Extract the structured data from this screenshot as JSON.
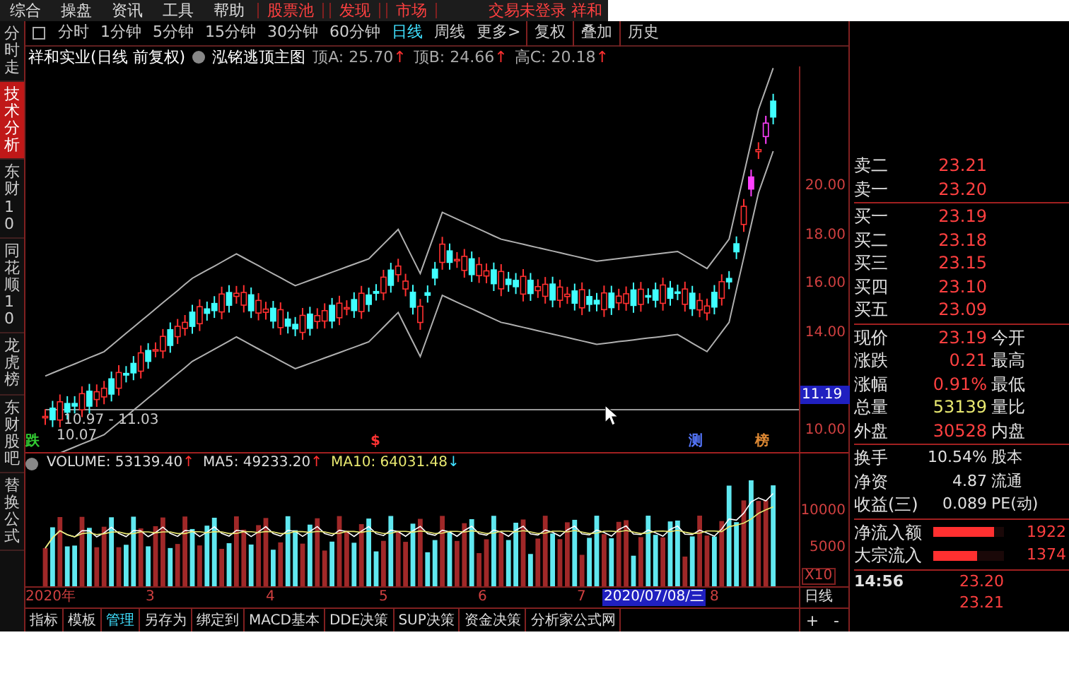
{
  "menu": {
    "items": [
      {
        "label": "综合",
        "kind": "plain"
      },
      {
        "label": "操盘",
        "kind": "plain"
      },
      {
        "label": "资讯",
        "kind": "plain"
      },
      {
        "label": "工具",
        "kind": "plain"
      },
      {
        "label": "帮助",
        "kind": "plain"
      },
      {
        "label": "股票池",
        "kind": "red"
      },
      {
        "label": "发现",
        "kind": "red"
      },
      {
        "label": "市场",
        "kind": "red"
      }
    ],
    "status": "交易未登录 祥和"
  },
  "side_tabs": [
    {
      "label": "分时走",
      "selected": false
    },
    {
      "label": "技术分析",
      "selected": true
    },
    {
      "label": "东财10",
      "selected": false
    },
    {
      "label": "同花顺10",
      "selected": false
    },
    {
      "label": "龙虎榜",
      "selected": false
    },
    {
      "label": "东财股吧",
      "selected": false
    },
    {
      "label": "替换公式",
      "selected": false
    }
  ],
  "period_tabs": [
    {
      "label": "分时",
      "selected": false
    },
    {
      "label": "1分钟",
      "selected": false
    },
    {
      "label": "5分钟",
      "selected": false
    },
    {
      "label": "15分钟",
      "selected": false
    },
    {
      "label": "30分钟",
      "selected": false
    },
    {
      "label": "60分钟",
      "selected": false
    },
    {
      "label": "日线",
      "selected": true
    },
    {
      "label": "周线",
      "selected": false
    },
    {
      "label": "更多>",
      "selected": false
    }
  ],
  "tool_buttons": [
    "复权",
    "叠加",
    "历史"
  ],
  "info": {
    "stock": "祥和实业(日线 前复权)",
    "indicator": "泓铭逃顶主图",
    "readings": [
      {
        "label": "顶A: 25.70",
        "arrow": "↑",
        "color": "#ff3030"
      },
      {
        "label": "顶B: 24.66",
        "arrow": "↑",
        "color": "#ff3030"
      },
      {
        "label": "高C: 20.18",
        "arrow": "↑",
        "color": "#ff3030"
      }
    ]
  },
  "chart": {
    "range_label": "10.97 - 11.03",
    "low_label": "10.07",
    "markers": [
      {
        "label": "跌",
        "color": "#33cc33"
      },
      {
        "label": "$",
        "color": "#ff3333"
      },
      {
        "label": "测",
        "color": "#5577ff"
      },
      {
        "label": "榜",
        "color": "#dd8833"
      }
    ]
  },
  "price_axis": {
    "labels": [
      "20.00",
      "18.00",
      "16.00",
      "14.00",
      "10.00"
    ],
    "current": "11.19"
  },
  "volume": {
    "readings": [
      {
        "label": "VOLUME: 53139.40",
        "arrow": "↑",
        "color": "#ff3030",
        "kind": "plain"
      },
      {
        "label": "MA5: 49233.20",
        "arrow": "↑",
        "color": "#ff3030",
        "kind": "plain"
      },
      {
        "label": "MA10: 64031.48",
        "arrow": "↓",
        "color": "#40e0ff",
        "kind": "yellow"
      }
    ],
    "axis": [
      "10000",
      "5000"
    ],
    "scale": "X10"
  },
  "dates": [
    {
      "label": "2020年",
      "selected": false
    },
    {
      "label": "3",
      "selected": false
    },
    {
      "label": "4",
      "selected": false
    },
    {
      "label": "5",
      "selected": false
    },
    {
      "label": "6",
      "selected": false
    },
    {
      "label": "7",
      "selected": false
    },
    {
      "label": "2020/07/08/三",
      "selected": true
    },
    {
      "label": "8",
      "selected": false
    }
  ],
  "period_label": "日线",
  "bottom_tabs": [
    {
      "label": "指标",
      "selected": false
    },
    {
      "label": "模板",
      "selected": false
    },
    {
      "label": "管理",
      "selected": true
    },
    {
      "label": "另存为",
      "selected": false
    },
    {
      "label": "绑定到",
      "selected": false
    },
    {
      "label": "MACD基本",
      "selected": false
    },
    {
      "label": "DDE决策",
      "selected": false
    },
    {
      "label": "SUP决策",
      "selected": false
    },
    {
      "label": "资金决策",
      "selected": false
    },
    {
      "label": "分析家公式网",
      "selected": false
    }
  ],
  "zoom_buttons": [
    "+",
    "-"
  ],
  "quote": {
    "asks": [
      {
        "label": "卖二",
        "value": "23.21"
      },
      {
        "label": "卖一",
        "value": "23.20"
      }
    ],
    "bids": [
      {
        "label": "买一",
        "value": "23.19"
      },
      {
        "label": "买二",
        "value": "23.18"
      },
      {
        "label": "买三",
        "value": "23.15"
      },
      {
        "label": "买四",
        "value": "23.10"
      },
      {
        "label": "买五",
        "value": "23.09"
      }
    ],
    "stats": [
      {
        "label": "现价",
        "value": "23.19",
        "extra": "今开",
        "color": "#ff4040"
      },
      {
        "label": "涨跌",
        "value": "0.21",
        "extra": "最高",
        "color": "#ff4040"
      },
      {
        "label": "涨幅",
        "value": "0.91%",
        "extra": "最低",
        "color": "#ff4040"
      },
      {
        "label": "总量",
        "value": "53139",
        "extra": "量比",
        "color": "#e8e870"
      },
      {
        "label": "外盘",
        "value": "30528",
        "extra": "内盘",
        "color": "#ff4040"
      }
    ],
    "fundamentals": [
      {
        "label": "换手",
        "value": "10.54%",
        "extra": "股本"
      },
      {
        "label": "净资",
        "value": "4.87",
        "extra": "流通"
      },
      {
        "label": "收益(三)",
        "value": "0.089",
        "extra": "PE(动)"
      }
    ],
    "flows": [
      {
        "label": "净流入额",
        "level": 0.85,
        "value": "1922"
      },
      {
        "label": "大宗流入",
        "level": 0.62,
        "value": "1374"
      }
    ],
    "ticks": [
      {
        "time": "14:56",
        "price": "23.20"
      },
      {
        "price": "23.21"
      }
    ]
  }
}
